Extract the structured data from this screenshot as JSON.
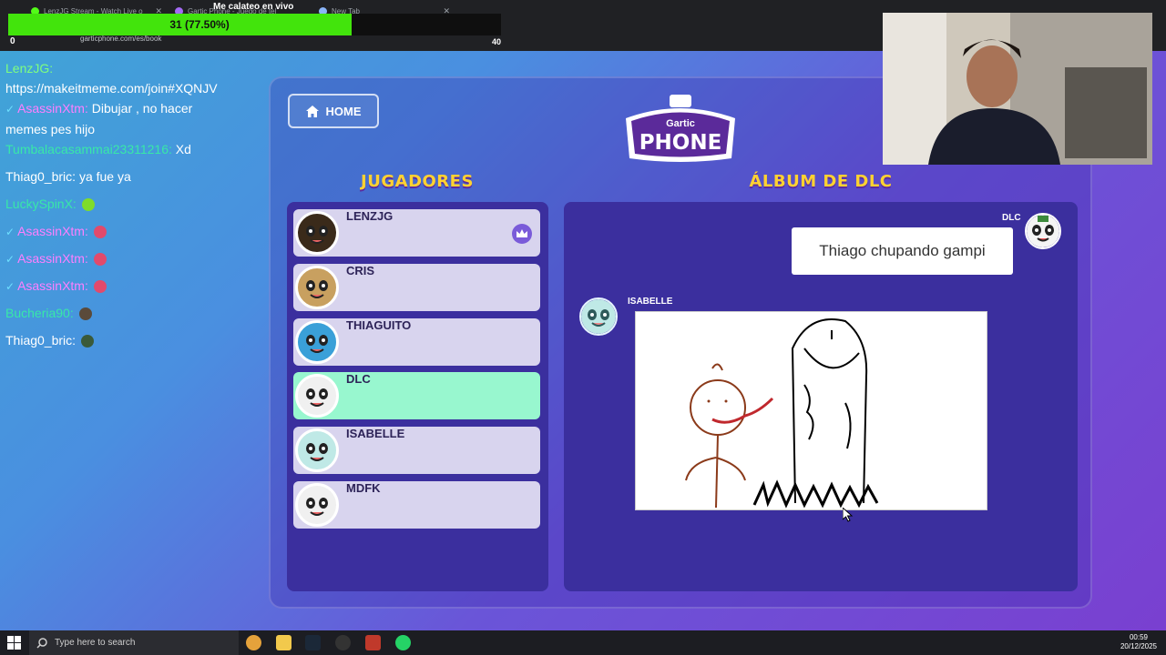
{
  "browser": {
    "tabs": [
      "LenzJG Stream - Watch Live o",
      "Gartic Phone - Juego de tel",
      "New Tab"
    ],
    "url": "garticphone.com/es/book"
  },
  "stream_overlay": {
    "title": "Me calateo en vivo",
    "progress_text": "31 (77.50%)",
    "progress_fraction": 0.775,
    "goal": "40",
    "left_count": "0"
  },
  "chat": [
    {
      "user": "LenzJG:",
      "text": "https://makeitmeme.com/join#XQNJV",
      "color": "#7fff7f",
      "badge": ""
    },
    {
      "user": "AsassinXtm:",
      "text": "Dibujar , no hacer memes pes hijo",
      "color": "#ff7fff",
      "badge": "✓"
    },
    {
      "user": "Tumbalacasammai23311216:",
      "text": "Xd",
      "color": "#38e8a8",
      "badge": ""
    },
    {
      "user": "Thiag0_bric:",
      "text": "ya fue ya",
      "color": "#ffffff",
      "badge": ""
    },
    {
      "user": "LuckySpinX:",
      "text": "",
      "color": "#38e8a8",
      "badge": ""
    },
    {
      "user": "AsassinXtm:",
      "text": "",
      "color": "#ff7fff",
      "badge": "✓"
    },
    {
      "user": "AsassinXtm:",
      "text": "",
      "color": "#ff7fff",
      "badge": "✓"
    },
    {
      "user": "AsassinXtm:",
      "text": "",
      "color": "#ff7fff",
      "badge": "✓"
    },
    {
      "user": "Bucheria90:",
      "text": "",
      "color": "#38e8a8",
      "badge": ""
    },
    {
      "user": "Thiag0_bric:",
      "text": "",
      "color": "#ffffff",
      "badge": ""
    }
  ],
  "game": {
    "home_label": "HOME",
    "logo_top": "Gartic",
    "logo_bottom": "PHONE",
    "players_title": "JUGADORES",
    "album_title": "ÁLBUM DE DLC",
    "players": [
      {
        "name": "LENZJG",
        "active": false,
        "host": true
      },
      {
        "name": "CRIS",
        "active": false,
        "host": false
      },
      {
        "name": "THIAGUITO",
        "active": false,
        "host": false
      },
      {
        "name": "DLC",
        "active": true,
        "host": false
      },
      {
        "name": "ISABELLE",
        "active": false,
        "host": false
      },
      {
        "name": "MDFK",
        "active": false,
        "host": false
      }
    ],
    "album": {
      "phrase_author": "DLC",
      "phrase": "Thiago chupando gampi",
      "drawing_author": "ISABELLE"
    }
  },
  "taskbar": {
    "search_placeholder": "Type here to search",
    "time": "00:59",
    "date": "20/12/2025"
  },
  "colors": {
    "accent_yellow": "#ffd231",
    "active_player": "#98f7cf",
    "progress_green": "#42e40c"
  }
}
